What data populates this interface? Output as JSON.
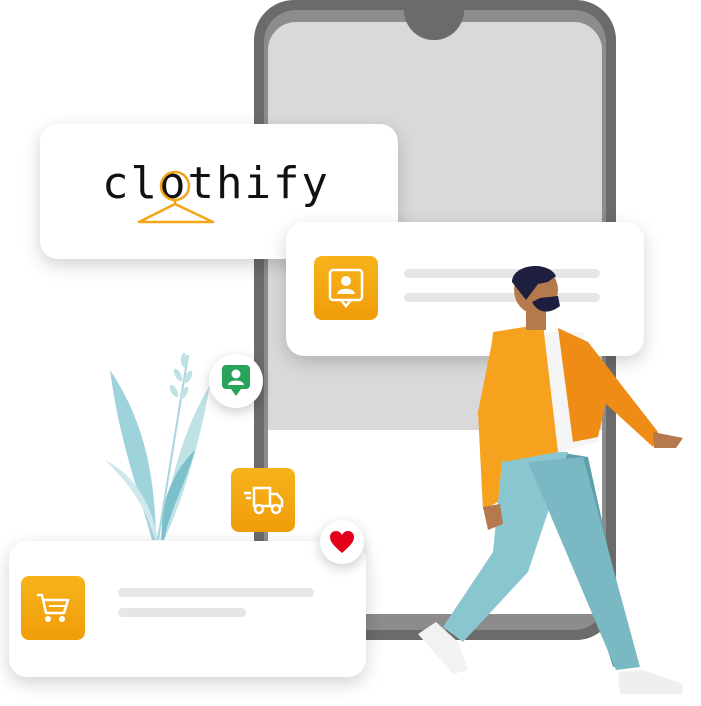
{
  "brand": {
    "name": "clothify",
    "accent": "#f2a516"
  },
  "icons": {
    "profile": "user-pin-icon",
    "location": "location-user-icon",
    "delivery": "delivery-truck-icon",
    "favorite": "heart-icon",
    "cart": "shopping-cart-icon"
  },
  "colors": {
    "tile_orange": "#f2a516",
    "pin_green": "#27a35a",
    "heart_red": "#e3001b",
    "phone_frame": "#6b6b6b",
    "phone_screen": "#d8d8d8"
  }
}
